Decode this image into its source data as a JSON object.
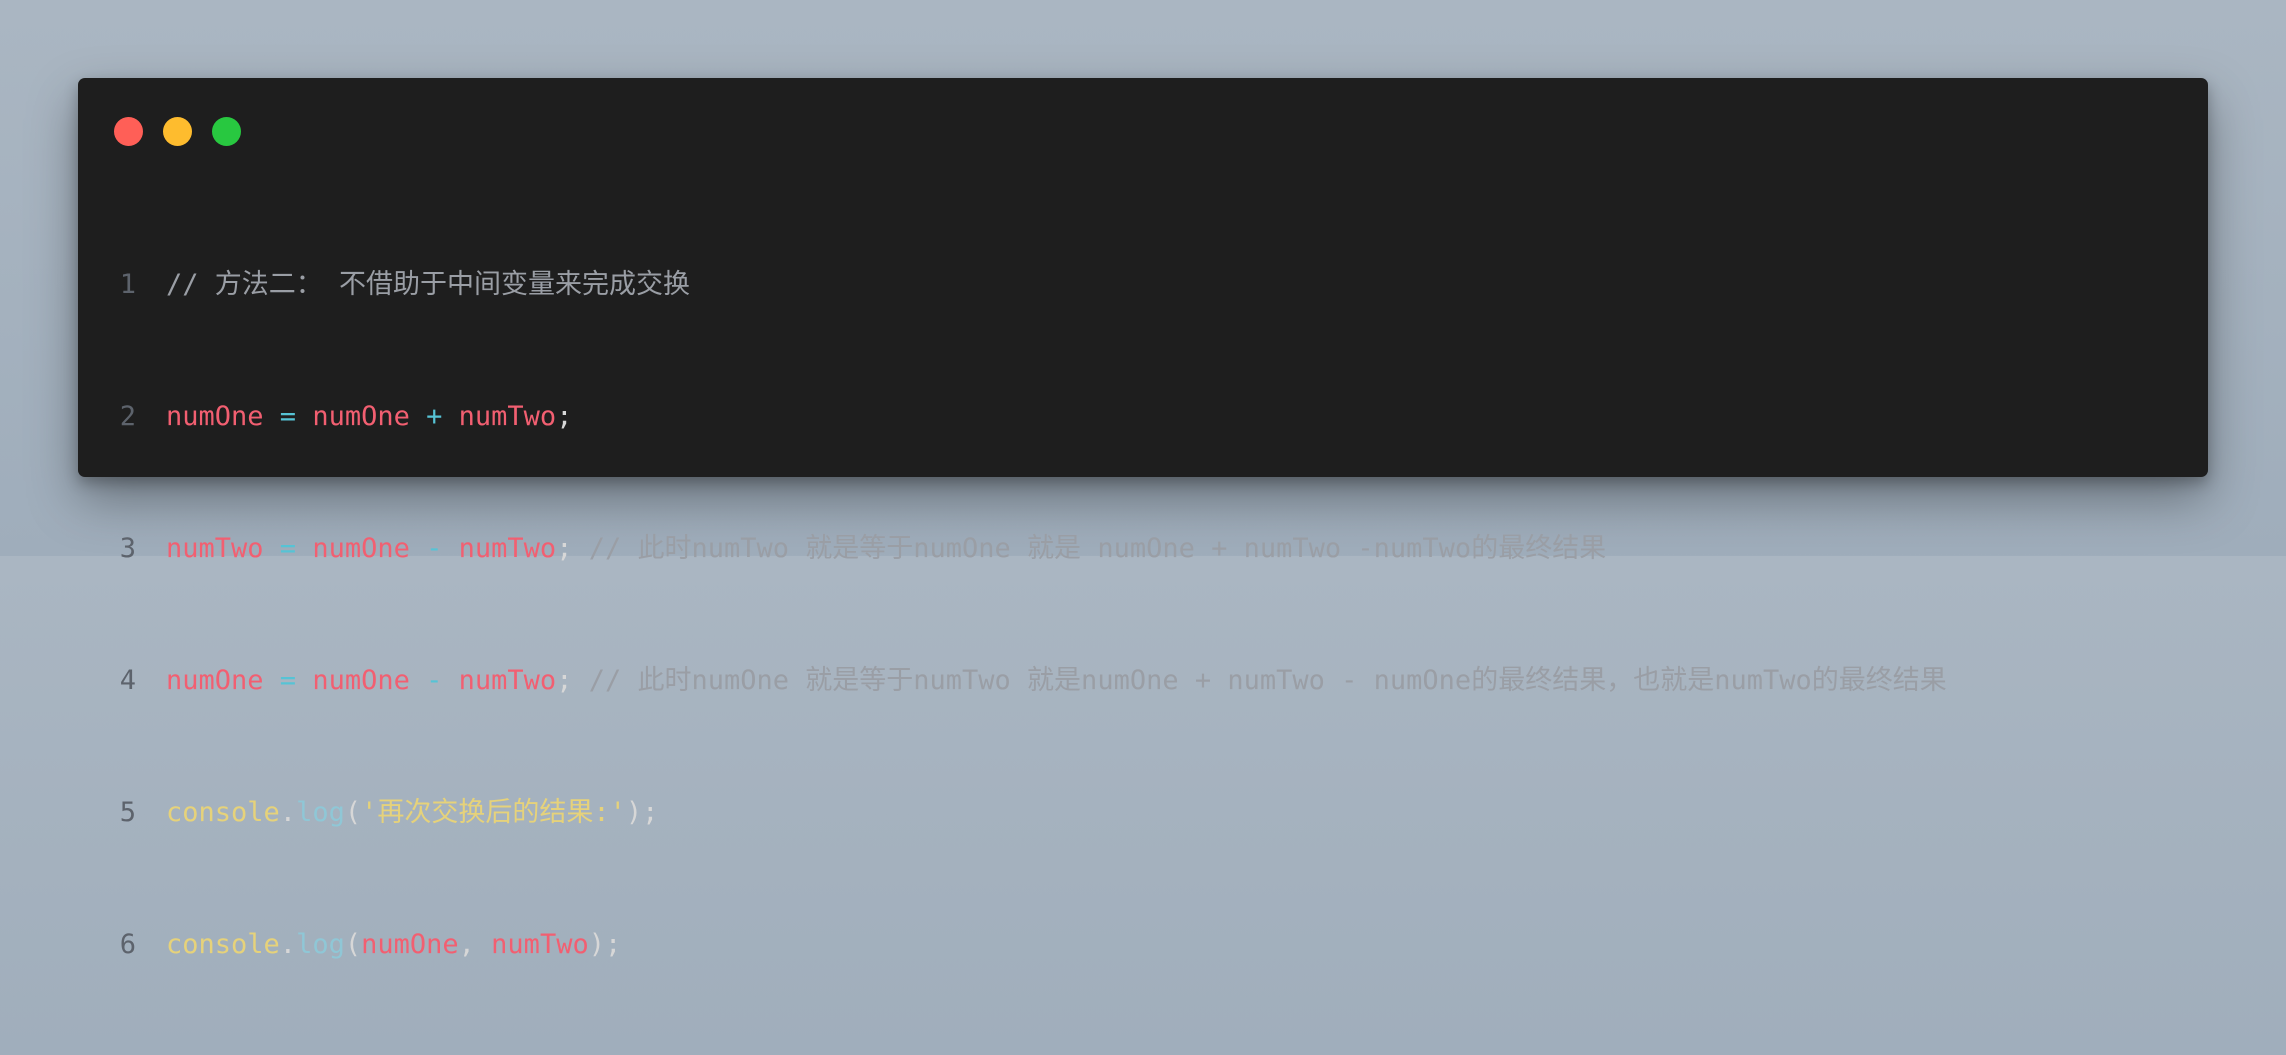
{
  "window": {
    "controls": [
      "close",
      "minimize",
      "maximize"
    ],
    "colors": {
      "background": "#1e1e1e",
      "close": "#ff5f57",
      "minimize": "#febc2e",
      "maximize": "#28c840"
    }
  },
  "code": {
    "line_numbers": [
      "1",
      "2",
      "3",
      "4",
      "5",
      "6"
    ],
    "lines": [
      {
        "comment": "// 方法二： 不借助于中间变量来完成交换"
      },
      {
        "a": "numOne",
        "eq": " = ",
        "b": "numOne",
        "op": " + ",
        "c": "numTwo",
        "end": ";"
      },
      {
        "a": "numTwo",
        "eq": " = ",
        "b": "numOne",
        "op": " - ",
        "c": "numTwo",
        "end": "; ",
        "comment": "// 此时numTwo 就是等于numOne 就是 numOne + numTwo -numTwo的最终结果"
      },
      {
        "a": "numOne",
        "eq": " = ",
        "b": "numOne",
        "op": " - ",
        "c": "numTwo",
        "end": "; ",
        "comment": "// 此时numOne 就是等于numTwo 就是numOne + numTwo - numOne的最终结果，也就是numTwo的最终结果"
      },
      {
        "obj": "console",
        "dot": ".",
        "fn": "log",
        "open": "(",
        "str": "'再次交换后的结果:'",
        "close": ");"
      },
      {
        "obj": "console",
        "dot": ".",
        "fn": "log",
        "open": "(",
        "arg1": "numOne",
        "sep": ", ",
        "arg2": "numTwo",
        "close": ");"
      }
    ]
  },
  "syntax_colors": {
    "comment": "#9a9ea5",
    "variable": "#f25f71",
    "operator": "#56c3d5",
    "object": "#e6d27a",
    "function": "#8fc7d6",
    "string": "#e6d27a"
  }
}
